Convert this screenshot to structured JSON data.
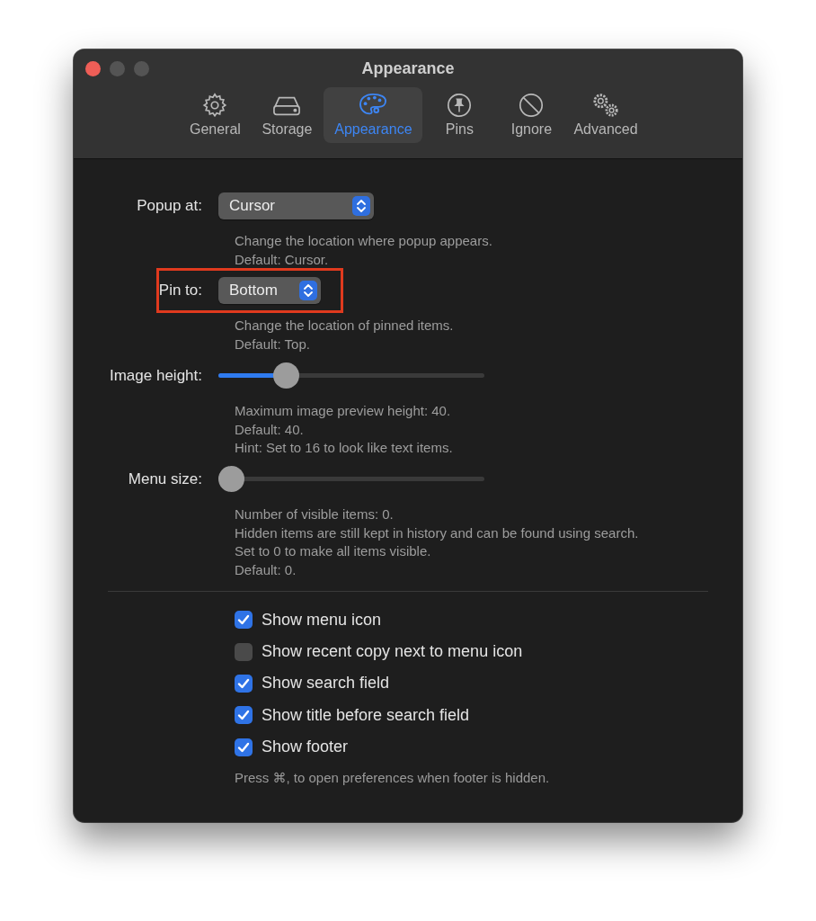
{
  "window": {
    "title": "Appearance"
  },
  "tabs": [
    {
      "label": "General",
      "selected": false
    },
    {
      "label": "Storage",
      "selected": false
    },
    {
      "label": "Appearance",
      "selected": true
    },
    {
      "label": "Pins",
      "selected": false
    },
    {
      "label": "Ignore",
      "selected": false
    },
    {
      "label": "Advanced",
      "selected": false
    }
  ],
  "settings": [
    {
      "kind": "popup",
      "label": "Popup at:",
      "value": "Cursor",
      "highlighted": false,
      "description": [
        "Change the location where popup appears.",
        "Default: Cursor."
      ]
    },
    {
      "kind": "popup",
      "label": "Pin to:",
      "value": "Bottom",
      "highlighted": true,
      "description": [
        "Change the location of pinned items.",
        "Default: Top."
      ]
    },
    {
      "kind": "slider",
      "label": "Image height:",
      "level": 0.23,
      "description": [
        "Maximum image preview height: 40.",
        "Default: 40.",
        "Hint: Set to 16 to look like text items."
      ]
    },
    {
      "kind": "slider",
      "label": "Menu size:",
      "level": 0,
      "description": [
        "Number of visible items: 0.",
        "Hidden items are still kept in history and can be found using search.",
        "Set to 0 to make all items visible.",
        "Default: 0."
      ]
    }
  ],
  "checkboxes": [
    {
      "label": "Show menu icon",
      "checked": true
    },
    {
      "label": "Show recent copy next to menu icon",
      "checked": false
    },
    {
      "label": "Show search field",
      "checked": true
    },
    {
      "label": "Show title before search field",
      "checked": true
    },
    {
      "label": "Show footer",
      "checked": true
    }
  ],
  "footnote": "Press ⌘, to open preferences when footer is hidden."
}
